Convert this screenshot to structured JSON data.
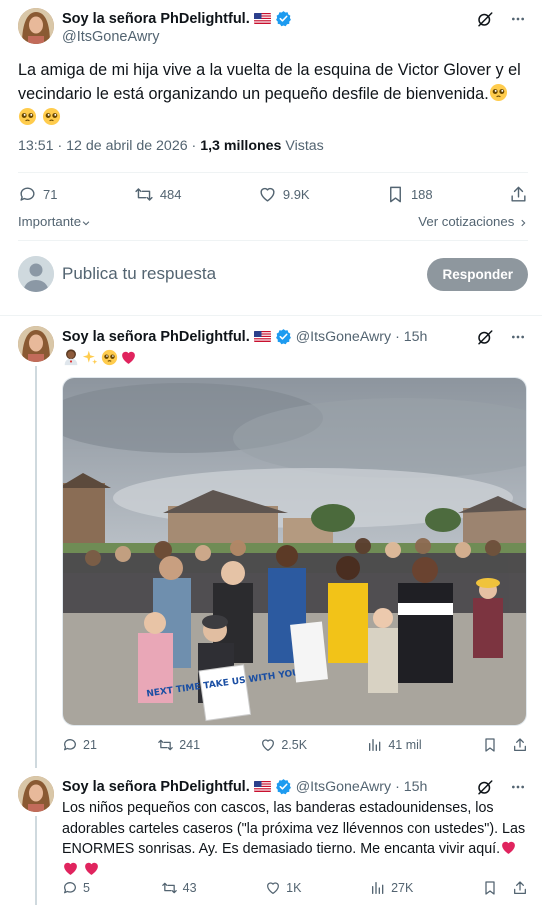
{
  "main_tweet": {
    "author_name": "Soy la señora PhDelightful.",
    "handle": "@ItsGoneAwry",
    "text": "La amiga de mi hija vive a la vuelta de la esquina de Victor Glover y el vecindario le está organizando un pequeño desfile de bienvenida.",
    "time": "13:51",
    "date": "12 de abril de 2026",
    "views_count": "1,3 millones",
    "views_label": "Vistas",
    "stats": {
      "replies": "71",
      "reposts": "484",
      "likes": "9.9K",
      "bookmarks": "188"
    },
    "relevance_label": "Importante",
    "quotes_link": "Ver cotizaciones"
  },
  "reply_composer": {
    "placeholder": "Publica tu respuesta",
    "button": "Responder"
  },
  "replies": [
    {
      "author_name": "Soy la señora PhDelightful.",
      "handle": "@ItsGoneAwry",
      "age": "· 15h",
      "stats": {
        "replies": "21",
        "reposts": "241",
        "likes": "2.5K",
        "views": "41 mil"
      },
      "photo_sign_text": "NEXT TIME TAKE US WITH YOU"
    },
    {
      "author_name": "Soy la señora PhDelightful.",
      "handle": "@ItsGoneAwry",
      "age": "· 15h",
      "text": "Los niños pequeños con cascos, las banderas estadounidenses, los adorables carteles caseros (\"la próxima vez llévennos con ustedes\"). Las ENORMES sonrisas. Ay. Es demasiado tierno. Me encanta vivir aquí.",
      "stats": {
        "replies": "5",
        "reposts": "43",
        "likes": "1K",
        "views": "27K"
      }
    }
  ],
  "colors": {
    "text": "#0f1419",
    "secondary": "#536471",
    "verified": "#1d9bf0",
    "divider": "#eff3f4",
    "reply_button": "#8e979e",
    "heart_emoji": "#e0245e"
  }
}
